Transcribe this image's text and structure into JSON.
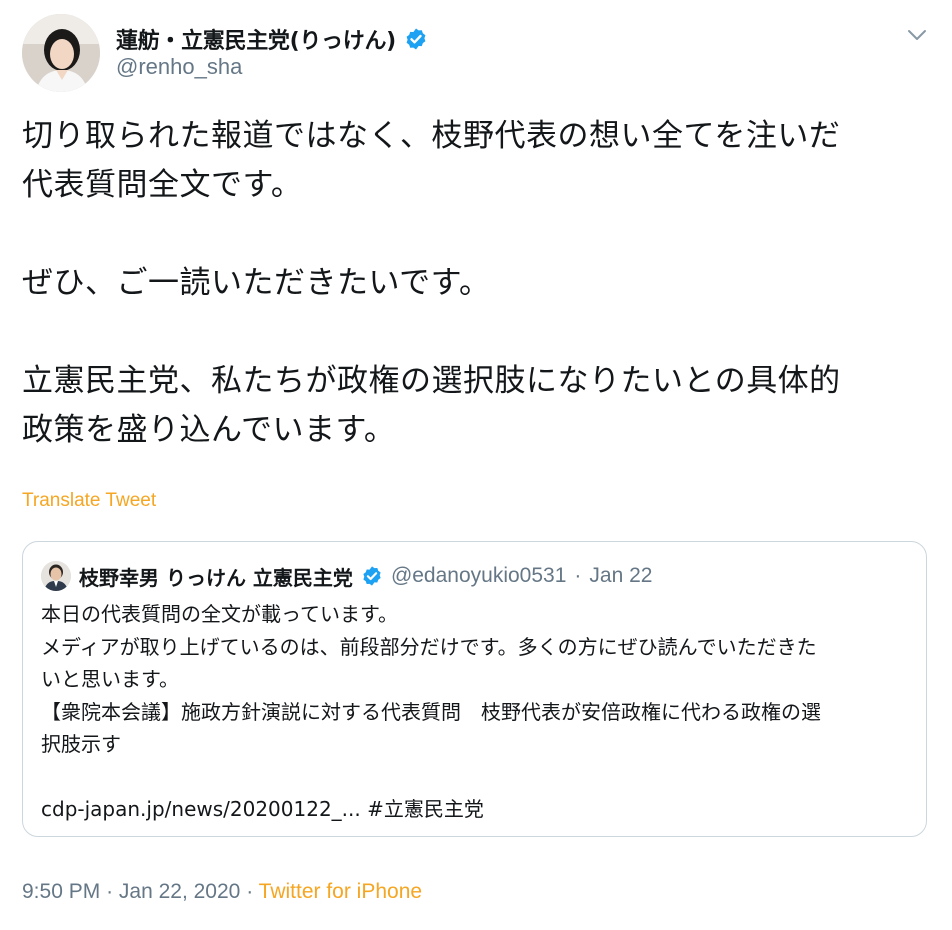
{
  "author": {
    "display_name": "蓮舫・立憲民主党(りっけん)",
    "handle": "@renho_sha",
    "verified_icon": "verified-badge-icon"
  },
  "tweet": {
    "text": "切り取られた報道ではなく、枝野代表の想い全てを注いだ\n代表質問全文です。\n\nぜひ、ご一読いただきたいです。\n\n立憲民主党、私たちが政権の選択肢になりたいとの具体的\n政策を盛り込んでいます。",
    "translate_label": "Translate Tweet"
  },
  "quoted_tweet": {
    "display_name": "枝野幸男 りっけん 立憲民主党",
    "handle": "@edanoyukio0531",
    "separator": "·",
    "date": "Jan 22",
    "text": "本日の代表質問の全文が載っています。\nメディアが取り上げているのは、前段部分だけです。多くの方にぜひ読んでいただきた\nいと思います。\n【衆院本会議】施政方針演説に対する代表質問　枝野代表が安倍政権に代わる政権の選\n択肢示す\n\ncdp-japan.jp/news/20200122_... #立憲民主党"
  },
  "meta": {
    "time": "9:50 PM",
    "separator": "·",
    "date": "Jan 22, 2020",
    "source": "Twitter for iPhone"
  },
  "colors": {
    "link_accent": "#f5a623",
    "verified_blue": "#1da1f2",
    "secondary_text": "#657786",
    "border": "#ccd6dd"
  }
}
